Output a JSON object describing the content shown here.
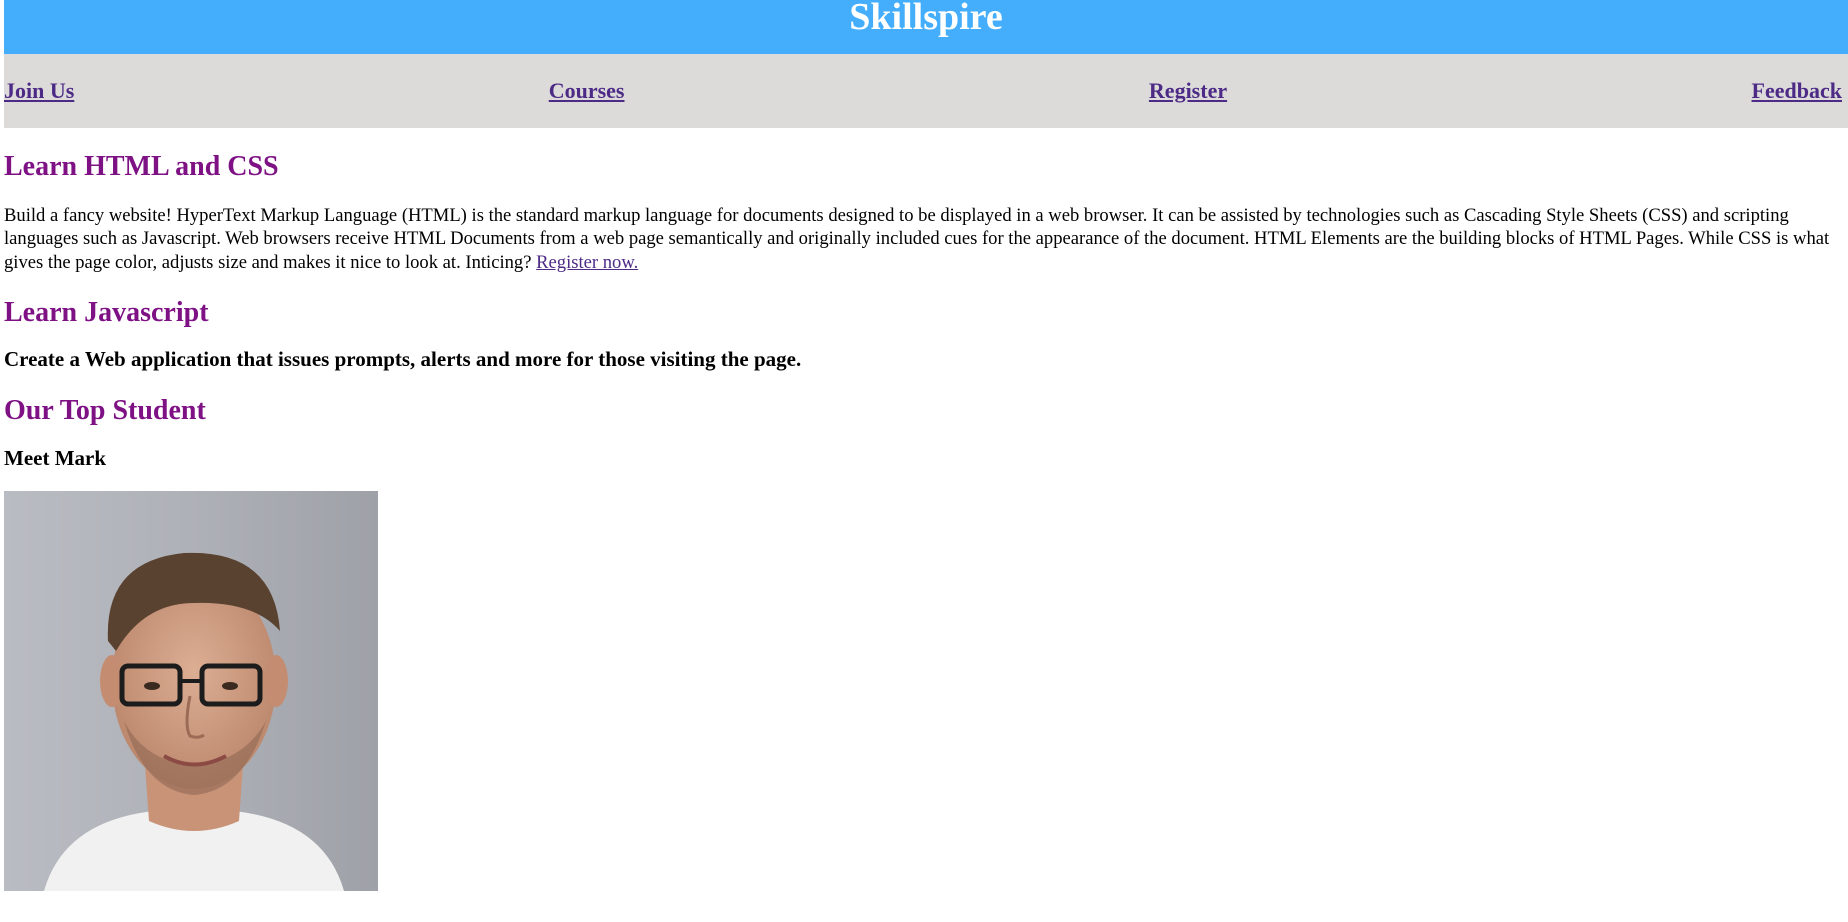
{
  "site": {
    "title": "Skillspire"
  },
  "nav": {
    "items": [
      {
        "label": "Join Us"
      },
      {
        "label": "Courses"
      },
      {
        "label": "Register"
      },
      {
        "label": "Feedback"
      }
    ]
  },
  "sections": {
    "html_css": {
      "heading": "Learn HTML and CSS",
      "body": "Build a fancy website! HyperText Markup Language (HTML) is the standard markup language for documents designed to be displayed in a web browser. It can be assisted by technologies such as Cascading Style Sheets (CSS) and scripting languages such as Javascript. Web browsers receive HTML Documents from a web page semantically and originally included cues for the appearance of the document. HTML Elements are the building blocks of HTML Pages. While CSS is what gives the page color, adjusts size and makes it nice to look at. Inticing? ",
      "link": "Register now."
    },
    "javascript": {
      "heading": "Learn Javascript",
      "subheading": "Create a Web application that issues prompts, alerts and more for those visiting the page."
    },
    "top_student": {
      "heading": "Our Top Student",
      "subheading": "Meet Mark"
    }
  },
  "colors": {
    "banner": "#44aefc",
    "nav_background": "#dcdbda",
    "heading": "#7e1285",
    "link": "#4d2a86"
  }
}
